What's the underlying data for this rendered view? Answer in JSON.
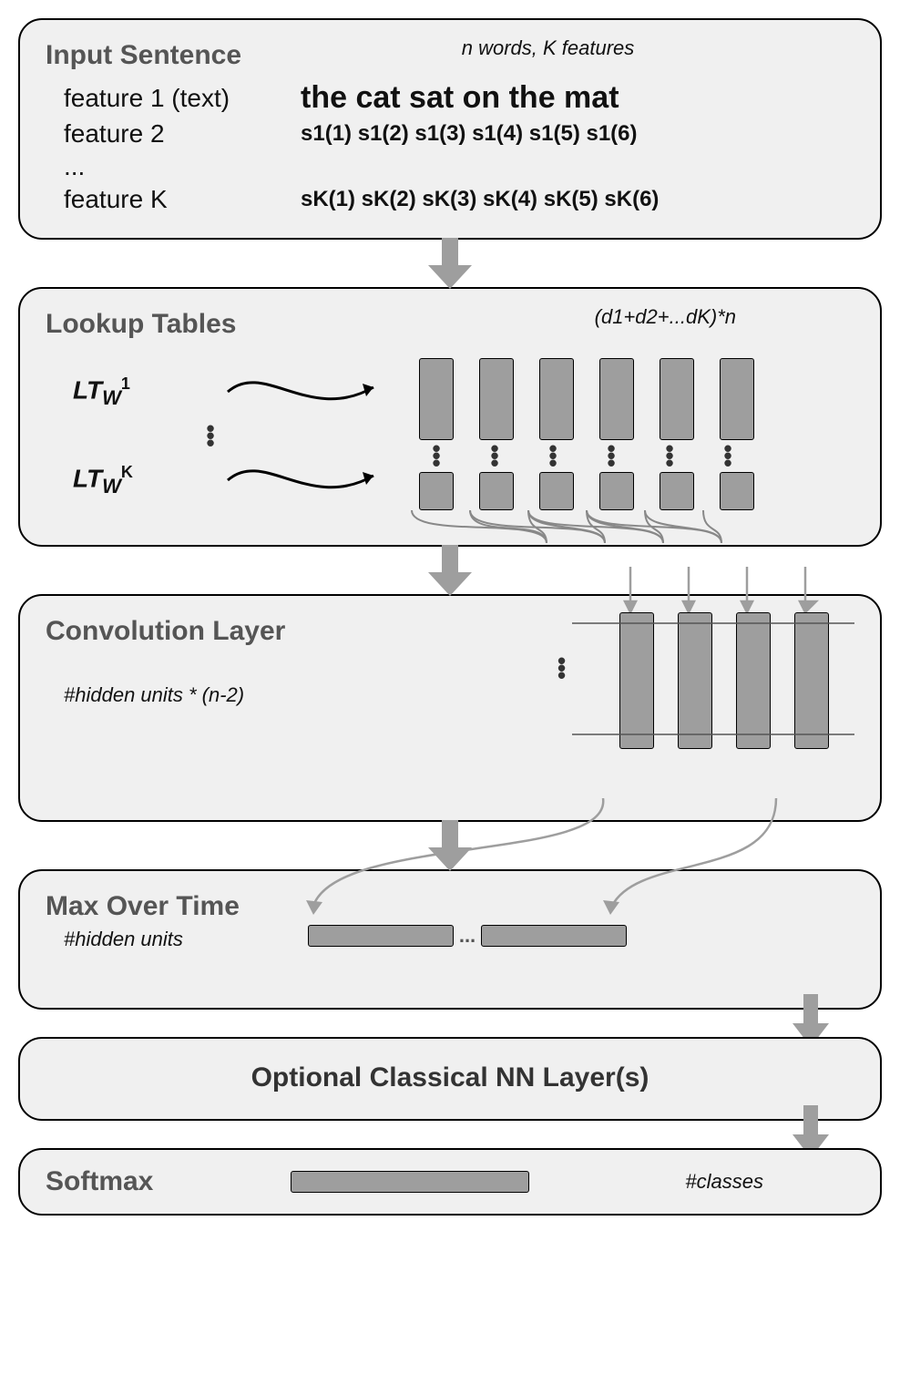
{
  "blocks": {
    "input": {
      "title": "Input Sentence",
      "caption": "n words, K features",
      "features": [
        {
          "label": "feature 1 (text)",
          "value": "the cat sat on the mat",
          "big": true
        },
        {
          "label": "feature 2",
          "value": "s1(1) s1(2) s1(3) s1(4) s1(5) s1(6)"
        },
        {
          "label": "...",
          "value": ""
        },
        {
          "label": "feature K",
          "value": "sK(1) sK(2) sK(3) sK(4) sK(5) sK(6)"
        }
      ]
    },
    "lookup": {
      "title": "Lookup Tables",
      "caption": "(d1+d2+...dK)*n",
      "lt1_label": "LT",
      "lt1_sub": "W",
      "lt1_sup": "1",
      "ltK_label": "LT",
      "ltK_sub": "W",
      "ltK_sup": "K"
    },
    "conv": {
      "title": "Convolution Layer",
      "note": "#hidden units * (n-2)"
    },
    "max": {
      "title": "Max Over Time",
      "note": "#hidden units",
      "ellipsis": "..."
    },
    "optional": {
      "title": "Optional Classical NN Layer(s)"
    },
    "softmax": {
      "title": "Softmax",
      "note": "#classes"
    }
  }
}
